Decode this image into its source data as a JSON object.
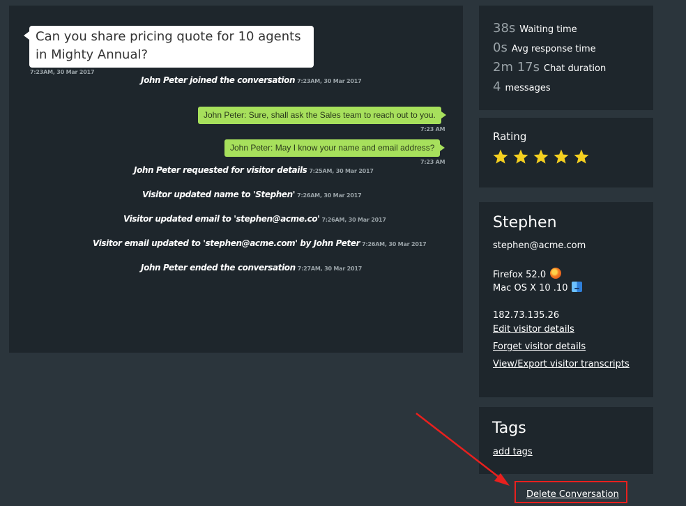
{
  "chat": {
    "visitor_message": "Can you share pricing quote for 10 agents in Mighty Annual?",
    "visitor_message_time": "7:23AM, 30 Mar 2017",
    "events": [
      {
        "text": "John Peter joined the conversation",
        "time": "7:23AM, 30 Mar 2017"
      },
      {
        "text": "John Peter requested for visitor details",
        "time": "7:25AM, 30 Mar 2017"
      },
      {
        "text": "Visitor updated name to 'Stephen'",
        "time": "7:26AM, 30 Mar 2017"
      },
      {
        "text": "Visitor updated email to 'stephen@acme.co'",
        "time": "7:26AM, 30 Mar 2017"
      },
      {
        "text": "Visitor email updated to 'stephen@acme.com' by John Peter",
        "time": "7:26AM, 30 Mar 2017"
      },
      {
        "text": "John Peter ended the conversation",
        "time": "7:27AM, 30 Mar 2017"
      }
    ],
    "agent_messages": [
      {
        "text": "John Peter: Sure, shall ask the Sales team to reach out to you.",
        "time": "7:23 AM"
      },
      {
        "text": "John Peter: May I know your name and email address?",
        "time": "7:23 AM"
      }
    ]
  },
  "stats": [
    {
      "value": "38s",
      "label": "Waiting time"
    },
    {
      "value": "0s",
      "label": "Avg response time"
    },
    {
      "value": "2m 17s",
      "label": "Chat duration"
    },
    {
      "value": "4",
      "label": "messages"
    }
  ],
  "rating": {
    "title": "Rating",
    "stars": 5,
    "star_color": "#f5d020"
  },
  "visitor": {
    "name": "Stephen",
    "email": "stephen@acme.com",
    "browser": "Firefox 52.0",
    "os": "Mac OS X 10 .10",
    "ip": "182.73.135.26",
    "links": {
      "edit": "Edit visitor details",
      "forget": "Forget visitor details",
      "export": "View/Export visitor transcripts"
    }
  },
  "tags": {
    "title": "Tags",
    "add_label": "add tags"
  },
  "delete_label": "Delete Conversation",
  "colors": {
    "background": "#2b353c",
    "panel": "#1e262c",
    "agent_bubble": "#a7e05c",
    "highlight": "#e8201e"
  }
}
